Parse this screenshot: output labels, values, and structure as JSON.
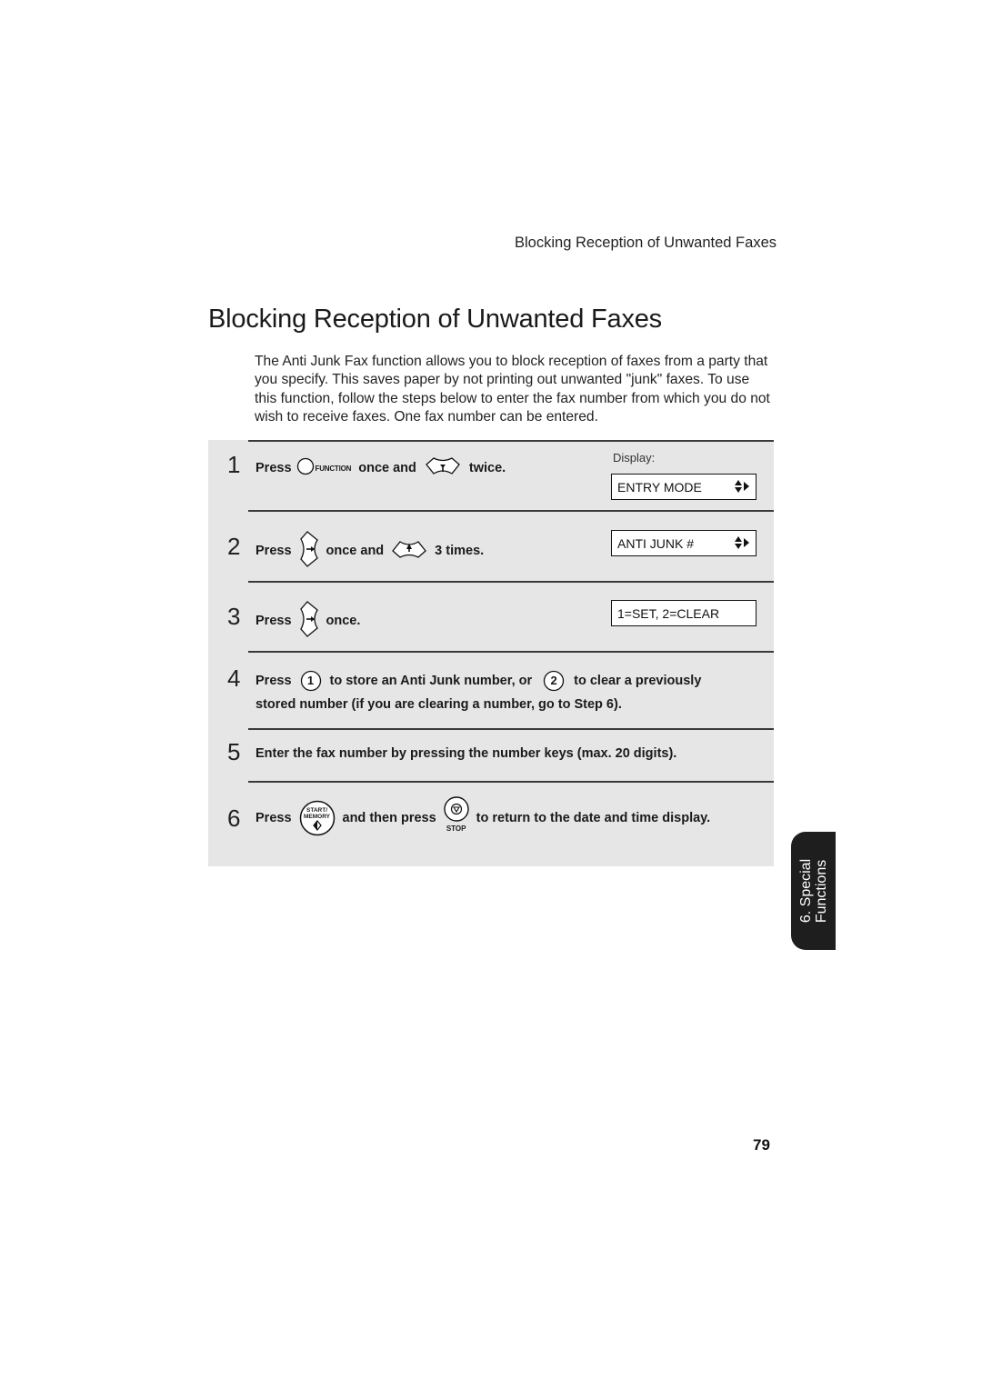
{
  "running_header": "Blocking Reception of Unwanted Faxes",
  "title": "Blocking Reception of Unwanted Faxes",
  "intro": "The Anti Junk Fax function allows you to block reception of faxes from a party that you specify. This saves paper by not printing out unwanted \"junk\" faxes. To use this function, follow the steps below to enter the fax number from which you do not wish to receive faxes. One fax number can be entered.",
  "display_label": "Display:",
  "steps": [
    {
      "number": "1",
      "press": "Press",
      "function_key_label": "FUNCTION",
      "once_and": "once and",
      "twice": "twice.",
      "display": "ENTRY MODE"
    },
    {
      "number": "2",
      "press": "Press",
      "once_and": "once and",
      "times": "3 times.",
      "display": "ANTI JUNK #"
    },
    {
      "number": "3",
      "press": "Press",
      "once": "once.",
      "display": "1=SET, 2=CLEAR"
    },
    {
      "number": "4",
      "press": "Press",
      "key1": "1",
      "text_a": "to store an Anti Junk number, or",
      "key2": "2",
      "text_b": "to clear a previously",
      "text_c": "stored number (if you are clearing a number, go to Step 6)."
    },
    {
      "number": "5",
      "text": "Enter the fax number by pressing the number keys (max. 20 digits)."
    },
    {
      "number": "6",
      "press": "Press",
      "start_key_line1": "START/",
      "start_key_line2": "MEMORY",
      "and_then_press": "and then press",
      "stop_key_label": "STOP",
      "text": "to return to the date and time display."
    }
  ],
  "side_tab": {
    "line1": "6. Special",
    "line2": "Functions"
  },
  "page_number": "79"
}
